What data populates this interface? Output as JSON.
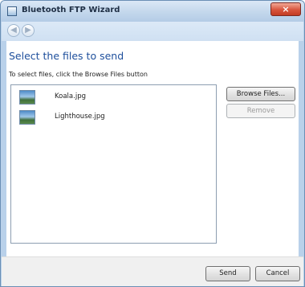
{
  "window": {
    "title": "Bluetooth FTP Wizard",
    "close_glyph": "×"
  },
  "nav": {
    "back_glyph": "◀",
    "forward_glyph": "▶"
  },
  "main": {
    "heading": "Select the files to send",
    "instruction": "To select files, click the Browse Files button",
    "files": [
      {
        "name": "Koala.jpg",
        "icon": "image-file-icon"
      },
      {
        "name": "Lighthouse.jpg",
        "icon": "image-file-icon"
      }
    ],
    "buttons": {
      "browse": "Browse Files...",
      "remove": "Remove"
    }
  },
  "footer": {
    "send": "Send",
    "cancel": "Cancel"
  },
  "colors": {
    "heading": "#1e4f9c",
    "window_frame": "#b9d1ea",
    "close_button": "#c23b22"
  }
}
